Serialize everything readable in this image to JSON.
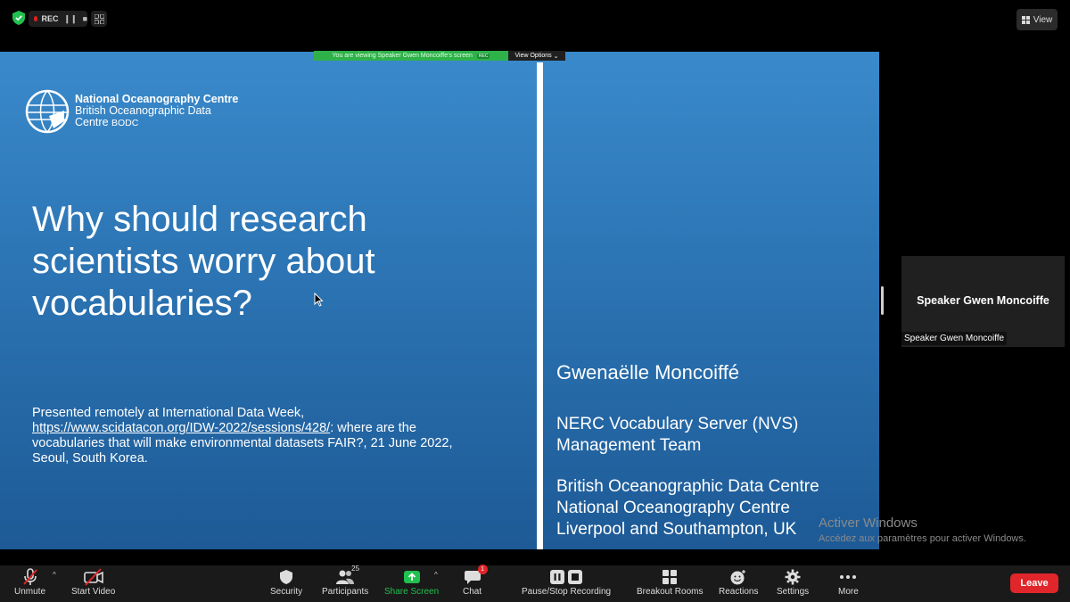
{
  "top_bar": {
    "rec_label": "REC",
    "view_label": "View"
  },
  "banner": {
    "viewing_text": "You are viewing Speaker Gwen Moncoiffe's screen",
    "rec_tag": "REC",
    "view_options_label": "View Options"
  },
  "slide": {
    "org_line1": "National Oceanography Centre",
    "org_line2": "British Oceanographic Data",
    "org_line3": "Centre",
    "org_abbrev": "BODC",
    "title_line1": "Why should research",
    "title_line2": "scientists worry about",
    "title_line3": "vocabularies?",
    "presented_prefix": "Presented remotely at International Data Week,",
    "presented_link": "https://www.scidatacon.org/IDW-2022/sessions/428/",
    "presented_suffix": ": where are the vocabularies that will make environmental datasets FAIR?, 21 June 2022, Seoul, South Korea.",
    "presenter_name": "Gwenaëlle Moncoiffé",
    "team_line1": "NERC Vocabulary Server (NVS)",
    "team_line2": "Management Team",
    "centre_line1": "British Oceanographic Data Centre",
    "centre_line2": "National Oceanography Centre",
    "centre_line3": "Liverpool and Southampton, UK"
  },
  "participant_tile": {
    "name": "Speaker Gwen Moncoiffe",
    "label": "Speaker Gwen Moncoiffe"
  },
  "watermark": {
    "line1": "Activer Windows",
    "line2": "Accédez aux paramètres pour activer Windows."
  },
  "toolbar": {
    "unmute": "Unmute",
    "start_video": "Start Video",
    "security": "Security",
    "participants": "Participants",
    "participants_count": "25",
    "share_screen": "Share Screen",
    "chat": "Chat",
    "chat_badge": "1",
    "recording": "Pause/Stop Recording",
    "breakout": "Breakout Rooms",
    "reactions": "Reactions",
    "settings": "Settings",
    "more": "More",
    "leave": "Leave"
  },
  "colors": {
    "accent_green": "#21c14f",
    "leave_red": "#e0262a",
    "slide_blue": "#2d76b6"
  }
}
